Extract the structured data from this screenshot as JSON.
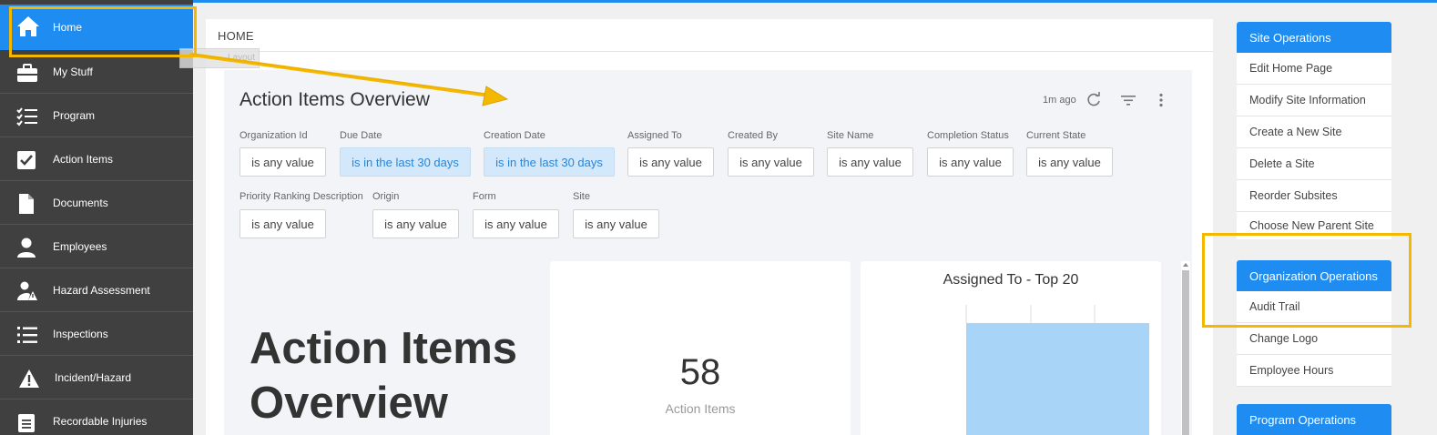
{
  "sidebar": {
    "items": [
      {
        "label": "Home",
        "icon": "home-icon"
      },
      {
        "label": "My Stuff",
        "icon": "briefcase-icon"
      },
      {
        "label": "Program",
        "icon": "checklist-icon"
      },
      {
        "label": "Action Items",
        "icon": "checkbox-icon"
      },
      {
        "label": "Documents",
        "icon": "document-icon"
      },
      {
        "label": "Employees",
        "icon": "person-icon"
      },
      {
        "label": "Hazard Assessment",
        "icon": "hazard-person-icon"
      },
      {
        "label": "Inspections",
        "icon": "list-icon"
      },
      {
        "label": "Incident/Hazard",
        "icon": "warning-icon"
      },
      {
        "label": "Recordable Injuries",
        "icon": "clipboard-icon"
      }
    ],
    "active_color": "#1e8cf0"
  },
  "breadcrumb": "HOME",
  "ghost_label": "Layout",
  "dashboard": {
    "title": "Action Items Overview",
    "updated": "1m ago",
    "filters": [
      {
        "label": "Organization Id",
        "value": "is any value"
      },
      {
        "label": "Due Date",
        "value": "is in the last 30 days"
      },
      {
        "label": "Creation Date",
        "value": "is in the last 30 days"
      },
      {
        "label": "Assigned To",
        "value": "is any value"
      },
      {
        "label": "Created By",
        "value": "is any value"
      },
      {
        "label": "Site Name",
        "value": "is any value"
      },
      {
        "label": "Completion Status",
        "value": "is any value"
      },
      {
        "label": "Current State",
        "value": "is any value"
      },
      {
        "label": "Priority Ranking Description",
        "value": "is any value"
      },
      {
        "label": "Origin",
        "value": "is any value"
      },
      {
        "label": "Form",
        "value": "is any value"
      },
      {
        "label": "Site",
        "value": "is any value"
      }
    ],
    "big_title_line1": "Action Items",
    "big_title_line2": "Overview",
    "count_tile": {
      "value": "58",
      "label": "Action Items"
    },
    "chart_tile": {
      "title": "Assigned To - Top 20",
      "bar_color": "#a8d4f7"
    }
  },
  "right_panel": {
    "site_ops": {
      "title": "Site Operations",
      "items": [
        "Edit Home Page",
        "Modify Site Information",
        "Create a New Site",
        "Delete a Site",
        "Reorder Subsites",
        "Choose New Parent Site"
      ]
    },
    "org_ops": {
      "title": "Organization Operations",
      "items": [
        "Audit Trail",
        "Change Logo",
        "Employee Hours"
      ]
    },
    "program_ops": {
      "title": "Program Operations"
    }
  },
  "annotation_color": "#f5b800"
}
